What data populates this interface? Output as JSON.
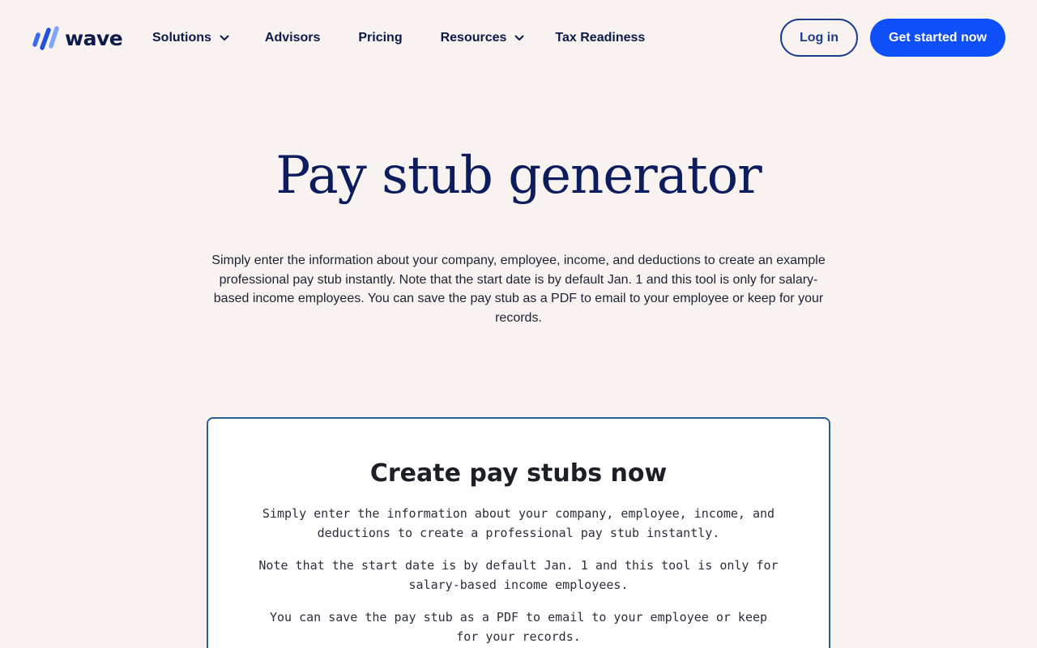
{
  "header": {
    "logo_text": "wave",
    "nav": [
      {
        "label": "Solutions",
        "has_dropdown": true
      },
      {
        "label": "Advisors",
        "has_dropdown": false
      },
      {
        "label": "Pricing",
        "has_dropdown": false
      },
      {
        "label": "Resources",
        "has_dropdown": true
      },
      {
        "label": "Tax Readiness",
        "has_dropdown": false
      }
    ],
    "login_label": "Log in",
    "cta_label": "Get started now"
  },
  "hero": {
    "title": "Pay stub generator",
    "description": "Simply enter the information about your company, employee, income, and deductions to create an example professional pay stub instantly. Note that the start date is by default Jan. 1 and this tool is only for salary-based income employees. You can save the pay stub as a PDF to email to your employee or keep for your records."
  },
  "card": {
    "title": "Create pay stubs now",
    "paragraphs": [
      "Simply enter the information about your company, employee, income, and deductions to create a professional pay stub instantly.",
      "Note that the start date is by default Jan. 1 and this tool is only for salary-based income employees.",
      "You can save the pay stub as a PDF to email to your employee or keep for your records."
    ]
  },
  "colors": {
    "background": "#f8f3f1",
    "brand_navy": "#0c1c5c",
    "brand_blue": "#0f4ffa",
    "card_border": "#2a5e93"
  },
  "icons": {
    "logo": "wave-logo-icon",
    "dropdown": "chevron-down-icon"
  }
}
